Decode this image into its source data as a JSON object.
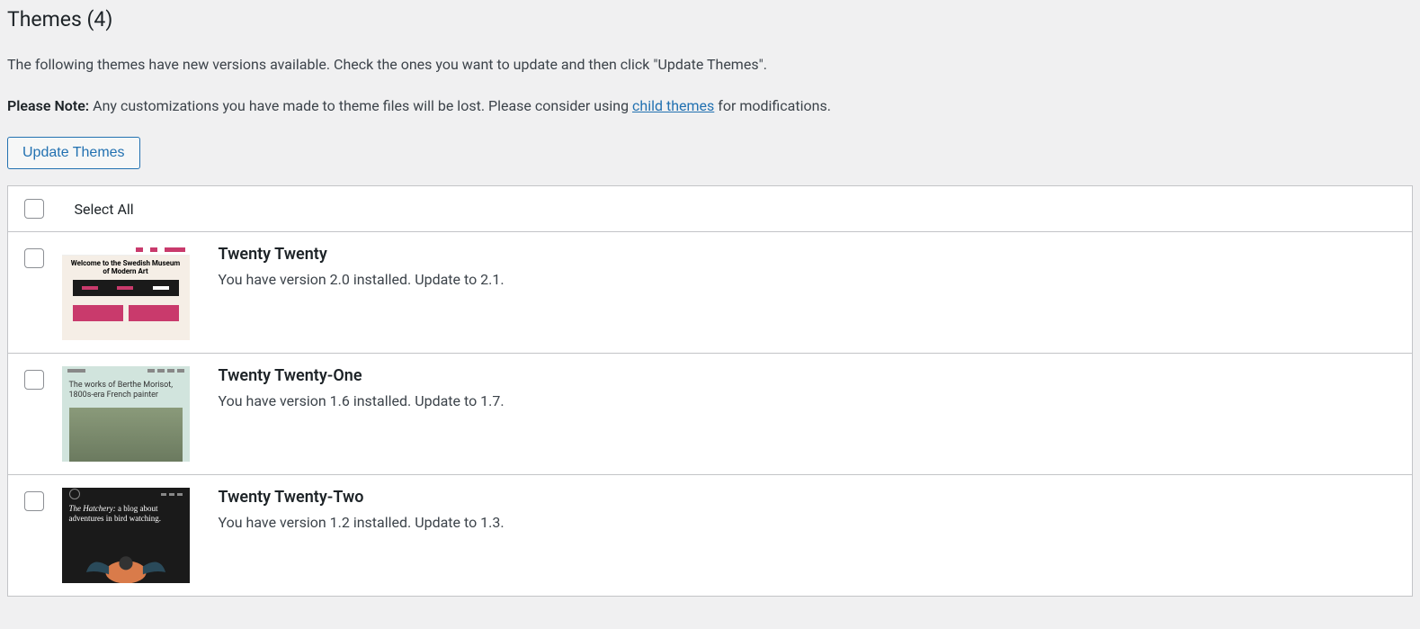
{
  "header": {
    "title": "Themes (4)"
  },
  "intro": "The following themes have new versions available. Check the ones you want to update and then click \"Update Themes\".",
  "note": {
    "label": "Please Note:",
    "before_link": " Any customizations you have made to theme files will be lost. Please consider using ",
    "link_text": "child themes",
    "after_link": " for modifications."
  },
  "buttons": {
    "update_themes": "Update Themes"
  },
  "table": {
    "select_all": "Select All"
  },
  "themes": [
    {
      "name": "Twenty Twenty",
      "description": "You have version 2.0 installed. Update to 2.1.",
      "thumb_text": "Welcome to the Swedish Museum of Modern Art"
    },
    {
      "name": "Twenty Twenty-One",
      "description": "You have version 1.6 installed. Update to 1.7.",
      "thumb_text": "The works of Berthe Morisot, 1800s-era French painter"
    },
    {
      "name": "Twenty Twenty-Two",
      "description": "You have version 1.2 installed. Update to 1.3.",
      "thumb_text_italic": "The Hatchery:",
      "thumb_text_rest": " a blog about adventures in bird watching."
    }
  ]
}
